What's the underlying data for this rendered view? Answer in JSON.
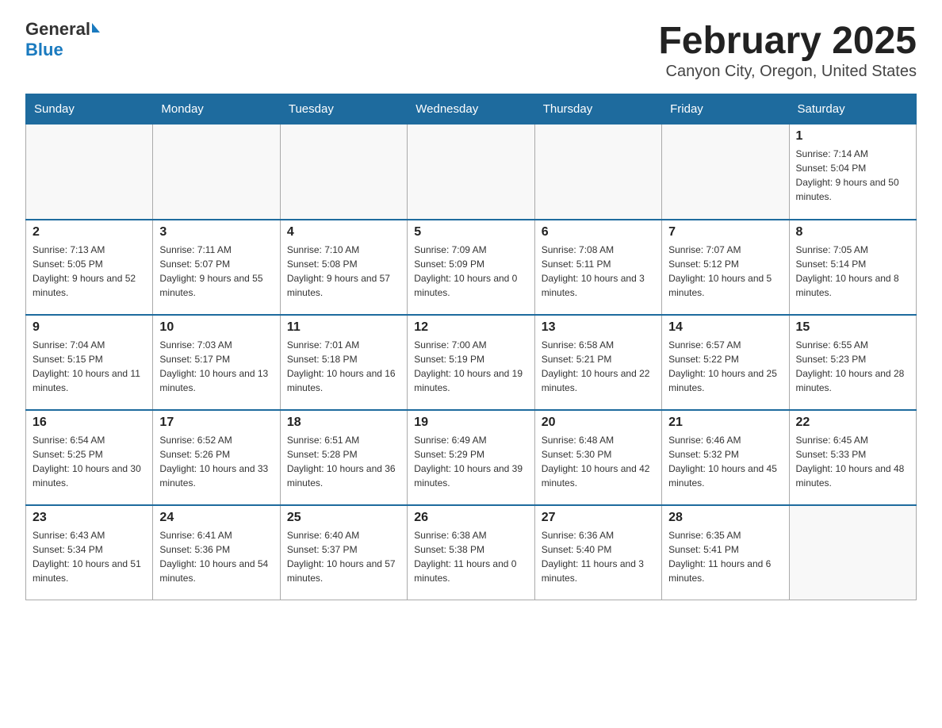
{
  "logo": {
    "general": "General",
    "blue": "Blue"
  },
  "title": "February 2025",
  "subtitle": "Canyon City, Oregon, United States",
  "weekdays": [
    "Sunday",
    "Monday",
    "Tuesday",
    "Wednesday",
    "Thursday",
    "Friday",
    "Saturday"
  ],
  "weeks": [
    [
      {
        "day": "",
        "info": ""
      },
      {
        "day": "",
        "info": ""
      },
      {
        "day": "",
        "info": ""
      },
      {
        "day": "",
        "info": ""
      },
      {
        "day": "",
        "info": ""
      },
      {
        "day": "",
        "info": ""
      },
      {
        "day": "1",
        "info": "Sunrise: 7:14 AM\nSunset: 5:04 PM\nDaylight: 9 hours and 50 minutes."
      }
    ],
    [
      {
        "day": "2",
        "info": "Sunrise: 7:13 AM\nSunset: 5:05 PM\nDaylight: 9 hours and 52 minutes."
      },
      {
        "day": "3",
        "info": "Sunrise: 7:11 AM\nSunset: 5:07 PM\nDaylight: 9 hours and 55 minutes."
      },
      {
        "day": "4",
        "info": "Sunrise: 7:10 AM\nSunset: 5:08 PM\nDaylight: 9 hours and 57 minutes."
      },
      {
        "day": "5",
        "info": "Sunrise: 7:09 AM\nSunset: 5:09 PM\nDaylight: 10 hours and 0 minutes."
      },
      {
        "day": "6",
        "info": "Sunrise: 7:08 AM\nSunset: 5:11 PM\nDaylight: 10 hours and 3 minutes."
      },
      {
        "day": "7",
        "info": "Sunrise: 7:07 AM\nSunset: 5:12 PM\nDaylight: 10 hours and 5 minutes."
      },
      {
        "day": "8",
        "info": "Sunrise: 7:05 AM\nSunset: 5:14 PM\nDaylight: 10 hours and 8 minutes."
      }
    ],
    [
      {
        "day": "9",
        "info": "Sunrise: 7:04 AM\nSunset: 5:15 PM\nDaylight: 10 hours and 11 minutes."
      },
      {
        "day": "10",
        "info": "Sunrise: 7:03 AM\nSunset: 5:17 PM\nDaylight: 10 hours and 13 minutes."
      },
      {
        "day": "11",
        "info": "Sunrise: 7:01 AM\nSunset: 5:18 PM\nDaylight: 10 hours and 16 minutes."
      },
      {
        "day": "12",
        "info": "Sunrise: 7:00 AM\nSunset: 5:19 PM\nDaylight: 10 hours and 19 minutes."
      },
      {
        "day": "13",
        "info": "Sunrise: 6:58 AM\nSunset: 5:21 PM\nDaylight: 10 hours and 22 minutes."
      },
      {
        "day": "14",
        "info": "Sunrise: 6:57 AM\nSunset: 5:22 PM\nDaylight: 10 hours and 25 minutes."
      },
      {
        "day": "15",
        "info": "Sunrise: 6:55 AM\nSunset: 5:23 PM\nDaylight: 10 hours and 28 minutes."
      }
    ],
    [
      {
        "day": "16",
        "info": "Sunrise: 6:54 AM\nSunset: 5:25 PM\nDaylight: 10 hours and 30 minutes."
      },
      {
        "day": "17",
        "info": "Sunrise: 6:52 AM\nSunset: 5:26 PM\nDaylight: 10 hours and 33 minutes."
      },
      {
        "day": "18",
        "info": "Sunrise: 6:51 AM\nSunset: 5:28 PM\nDaylight: 10 hours and 36 minutes."
      },
      {
        "day": "19",
        "info": "Sunrise: 6:49 AM\nSunset: 5:29 PM\nDaylight: 10 hours and 39 minutes."
      },
      {
        "day": "20",
        "info": "Sunrise: 6:48 AM\nSunset: 5:30 PM\nDaylight: 10 hours and 42 minutes."
      },
      {
        "day": "21",
        "info": "Sunrise: 6:46 AM\nSunset: 5:32 PM\nDaylight: 10 hours and 45 minutes."
      },
      {
        "day": "22",
        "info": "Sunrise: 6:45 AM\nSunset: 5:33 PM\nDaylight: 10 hours and 48 minutes."
      }
    ],
    [
      {
        "day": "23",
        "info": "Sunrise: 6:43 AM\nSunset: 5:34 PM\nDaylight: 10 hours and 51 minutes."
      },
      {
        "day": "24",
        "info": "Sunrise: 6:41 AM\nSunset: 5:36 PM\nDaylight: 10 hours and 54 minutes."
      },
      {
        "day": "25",
        "info": "Sunrise: 6:40 AM\nSunset: 5:37 PM\nDaylight: 10 hours and 57 minutes."
      },
      {
        "day": "26",
        "info": "Sunrise: 6:38 AM\nSunset: 5:38 PM\nDaylight: 11 hours and 0 minutes."
      },
      {
        "day": "27",
        "info": "Sunrise: 6:36 AM\nSunset: 5:40 PM\nDaylight: 11 hours and 3 minutes."
      },
      {
        "day": "28",
        "info": "Sunrise: 6:35 AM\nSunset: 5:41 PM\nDaylight: 11 hours and 6 minutes."
      },
      {
        "day": "",
        "info": ""
      }
    ]
  ]
}
